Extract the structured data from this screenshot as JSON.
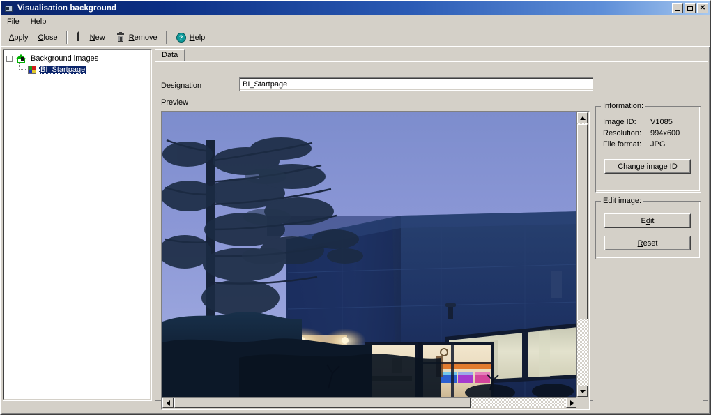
{
  "window": {
    "title": "Visualisation background",
    "icon": "house-window-icon",
    "buttons": {
      "minimize": "minimize-button",
      "maximize": "maximize-button",
      "close": "close-button",
      "close_glyph": "✕"
    }
  },
  "menubar": {
    "items": [
      {
        "label": "File"
      },
      {
        "label": "Help"
      }
    ]
  },
  "toolbar": {
    "items": [
      {
        "label": "Apply",
        "accel": "A",
        "icon": null
      },
      {
        "label": "Close",
        "accel": "C",
        "icon": null
      },
      {
        "label": "New",
        "accel": "N",
        "icon": "page-icon"
      },
      {
        "label": "Remove",
        "accel": "R",
        "icon": "trash-icon"
      },
      {
        "label": "Help",
        "accel": "H",
        "icon": "help-circle-icon",
        "glyph": "?"
      }
    ]
  },
  "tree": {
    "root": {
      "label": "Background images",
      "icon": "green-house-icon",
      "expanded": true,
      "expander_glyph": "-"
    },
    "children": [
      {
        "label": "BI_Startpage",
        "icon": "color-squares-icon",
        "selected": true
      }
    ]
  },
  "tabs": [
    {
      "label": "Data",
      "active": true
    }
  ],
  "form": {
    "designation_label": "Designation",
    "designation_value": "BI_Startpage",
    "preview_label": "Preview"
  },
  "information": {
    "group_title": "Information:",
    "rows": [
      {
        "label": "Image ID:",
        "value": "V1085"
      },
      {
        "label": "Resolution:",
        "value": "994x600"
      },
      {
        "label": "File format:",
        "value": "JPG"
      }
    ],
    "change_button": "Change image ID"
  },
  "edit_image": {
    "group_title": "Edit image:",
    "buttons": [
      {
        "label": "Edit",
        "accel": "d"
      },
      {
        "label": "Reset",
        "accel": "R"
      }
    ]
  },
  "scrollbars": {
    "vertical": {
      "up": "scroll-up-arrow",
      "down": "scroll-down-arrow",
      "thumb_percent": 75
    },
    "horizontal": {
      "left": "scroll-left-arrow",
      "right": "scroll-right-arrow",
      "thumb_percent": 75
    }
  },
  "colors": {
    "titlebar_start": "#0a246a",
    "titlebar_end": "#a6c8f0",
    "face": "#d4d0c8",
    "selection": "#0a246a",
    "sky_top": "#7f8fd0",
    "sky_bottom": "#9aa4dc",
    "building": "#1e3a6e",
    "window_glow": "#e8e4cf"
  }
}
